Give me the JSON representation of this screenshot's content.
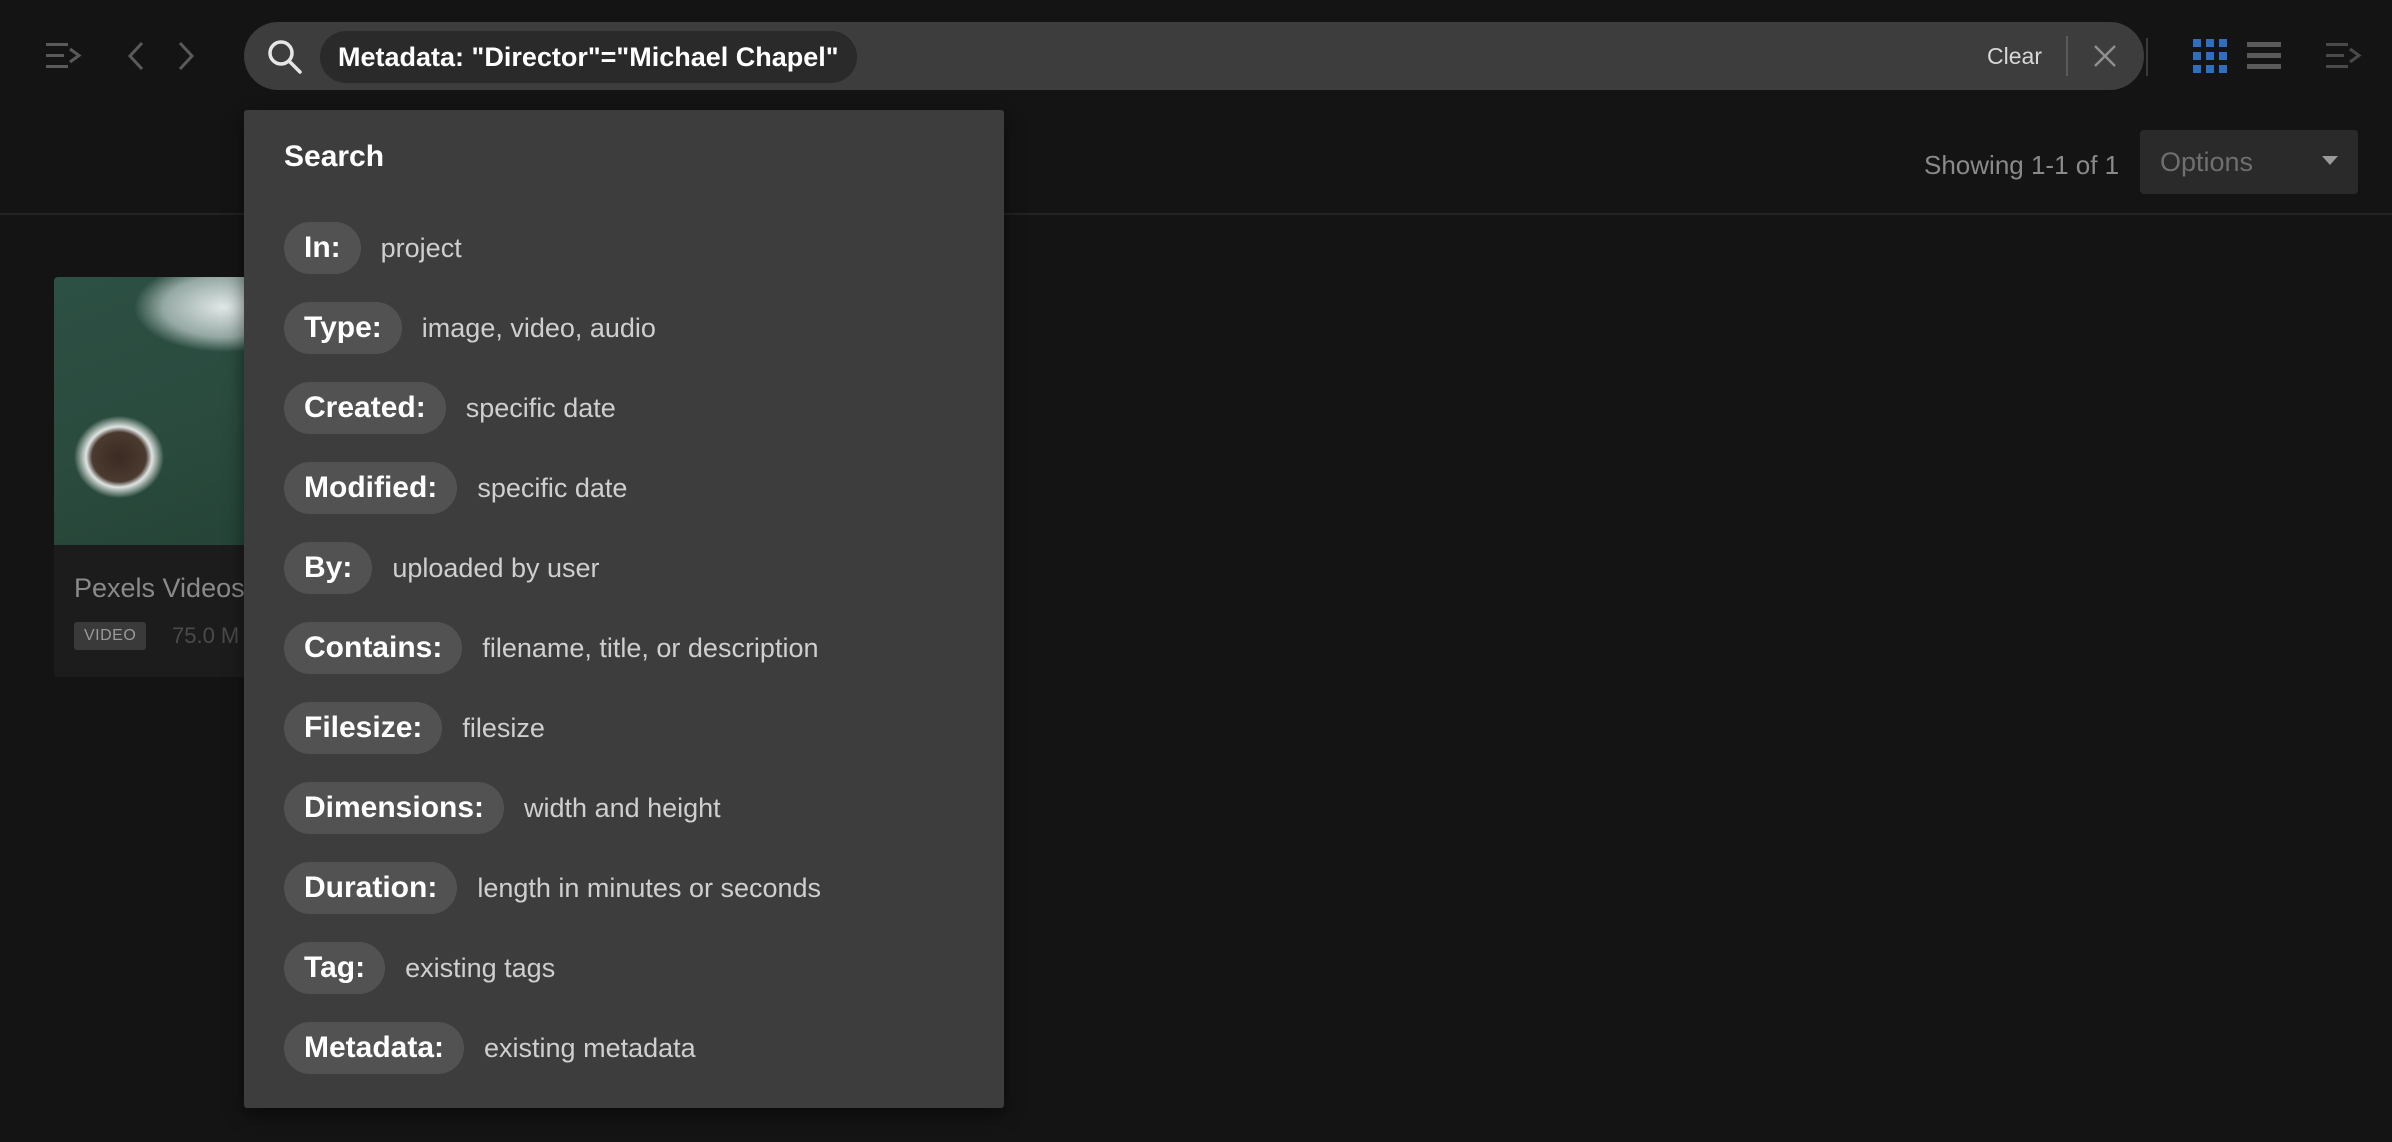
{
  "search": {
    "query_chip": "Metadata: \"Director\"=\"Michael Chapel\"",
    "clear_label": "Clear"
  },
  "results": {
    "showing_text": "Showing 1-1 of 1",
    "options_label": "Options"
  },
  "asset_card": {
    "title": "Pexels Videos",
    "badge": "VIDEO",
    "size": "75.0 M"
  },
  "dropdown": {
    "title": "Search",
    "filters": [
      {
        "key": "In:",
        "desc": "project"
      },
      {
        "key": "Type:",
        "desc": "image, video, audio"
      },
      {
        "key": "Created:",
        "desc": "specific date"
      },
      {
        "key": "Modified:",
        "desc": "specific date"
      },
      {
        "key": "By:",
        "desc": "uploaded by user"
      },
      {
        "key": "Contains:",
        "desc": "filename, title, or description"
      },
      {
        "key": "Filesize:",
        "desc": "filesize"
      },
      {
        "key": "Dimensions:",
        "desc": "width and height"
      },
      {
        "key": "Duration:",
        "desc": "length in minutes or seconds"
      },
      {
        "key": "Tag:",
        "desc": "existing tags"
      },
      {
        "key": "Metadata:",
        "desc": "existing metadata"
      }
    ]
  },
  "colors": {
    "accent_grid_view": "#2f6fc0",
    "background": "#141414",
    "panel": "#3d3d3d"
  },
  "icons": {
    "left_sidebar_toggle": "collapse-left-icon",
    "back": "chevron-left-icon",
    "forward": "chevron-right-icon",
    "search": "search-icon",
    "close": "close-icon",
    "grid_view": "grid-view-icon",
    "list_view": "list-view-icon",
    "right_sidebar_toggle": "collapse-right-icon"
  }
}
